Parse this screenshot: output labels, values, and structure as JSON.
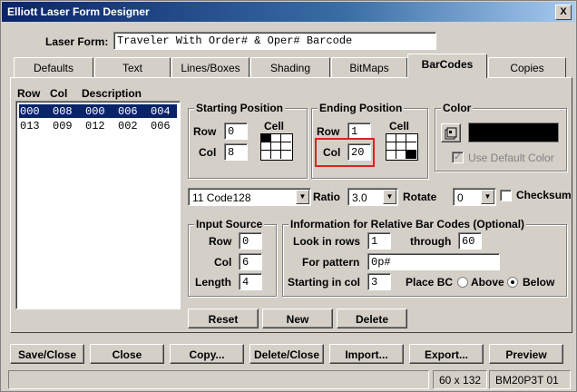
{
  "window": {
    "title": "Elliott Laser Form Designer",
    "close_glyph": "X"
  },
  "laser_form": {
    "label": "Laser Form:",
    "value": "Traveler With Order# & Oper# Barcode"
  },
  "tabs": [
    {
      "label": "Defaults"
    },
    {
      "label": "Text"
    },
    {
      "label": "Lines/Boxes"
    },
    {
      "label": "Shading"
    },
    {
      "label": "BitMaps"
    },
    {
      "label": "BarCodes"
    },
    {
      "label": "Copies"
    }
  ],
  "list": {
    "headers": {
      "row": "Row",
      "col": "Col",
      "desc": "Description"
    },
    "rows": [
      "000  008  000  006  004",
      "013  009  012  002  006"
    ]
  },
  "starting_position": {
    "title": "Starting Position",
    "row_label": "Row",
    "row_value": "0",
    "col_label": "Col",
    "col_value": "8",
    "cell_label": "Cell"
  },
  "ending_position": {
    "title": "Ending Position",
    "row_label": "Row",
    "row_value": "1",
    "col_label": "Col",
    "col_value": "20",
    "cell_label": "Cell"
  },
  "color": {
    "title": "Color",
    "swatch": "#000000",
    "use_default_label": "Use Default Color",
    "use_default_checked": true,
    "picker_icon": "palette-icon"
  },
  "barcode_type": {
    "value": "11 Code128"
  },
  "ratio": {
    "label": "Ratio",
    "value": "3.0"
  },
  "rotate": {
    "label": "Rotate",
    "value": "0"
  },
  "checksum": {
    "label": "Checksum",
    "checked": false
  },
  "input_source": {
    "title": "Input Source",
    "row_label": "Row",
    "row_value": "0",
    "col_label": "Col",
    "col_value": "6",
    "length_label": "Length",
    "length_value": "4"
  },
  "relative": {
    "title": "Information for Relative Bar Codes (Optional)",
    "look_in_rows_label": "Look in rows",
    "look_from": "1",
    "through_label": "through",
    "look_to": "60",
    "pattern_label": "For pattern",
    "pattern_value": "0p#",
    "starting_col_label": "Starting in col",
    "starting_col_value": "3",
    "place_bc_label": "Place BC",
    "above_label": "Above",
    "below_label": "Below",
    "place_selected": "Below"
  },
  "list_buttons": {
    "reset": "Reset",
    "new": "New",
    "delete": "Delete"
  },
  "bottom_buttons": {
    "save_close": "Save/Close",
    "close": "Close",
    "copy": "Copy...",
    "delete_close": "Delete/Close",
    "import": "Import...",
    "export": "Export...",
    "preview": "Preview"
  },
  "status": {
    "left": "",
    "size": "60 x 132",
    "code": "BM20P3T 01"
  },
  "highlight_color": "#e02020",
  "selection_color": "#0a246a"
}
